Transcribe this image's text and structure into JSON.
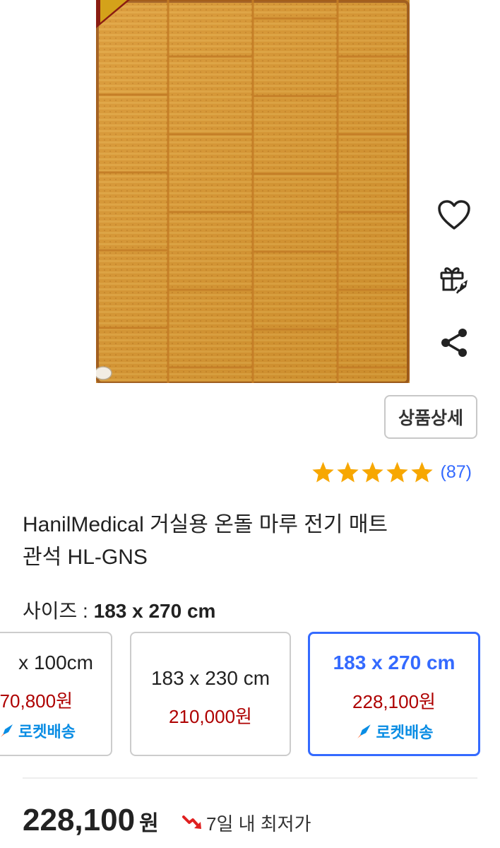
{
  "actions": {
    "wishlist_icon": "heart-outline",
    "gift_icon": "gift",
    "share_icon": "share"
  },
  "details_button": {
    "label": "상품상세"
  },
  "rating": {
    "stars": 5,
    "count_text": "(87)",
    "star_color": "#f7a701"
  },
  "product": {
    "title_line1": "HanilMedical 거실용 온돌 마루 전기 매트",
    "title_line2": "관석 HL-GNS"
  },
  "size": {
    "label": "사이즈 : ",
    "selected": "183 x 270 cm"
  },
  "options": [
    {
      "size": "x 100cm",
      "price": "70,800원",
      "badge": "로켓배송"
    },
    {
      "size": "183 x 230 cm",
      "price": "210,000원",
      "badge": ""
    },
    {
      "size": "183 x 270 cm",
      "price": "228,100원",
      "badge": "로켓배송"
    }
  ],
  "final": {
    "amount": "228,100",
    "currency": "원",
    "lowest_label": "7일 내 최저가"
  },
  "colors": {
    "accent_blue": "#346aff",
    "price_red": "#ae0000",
    "rocket_blue": "#0a8de4"
  }
}
